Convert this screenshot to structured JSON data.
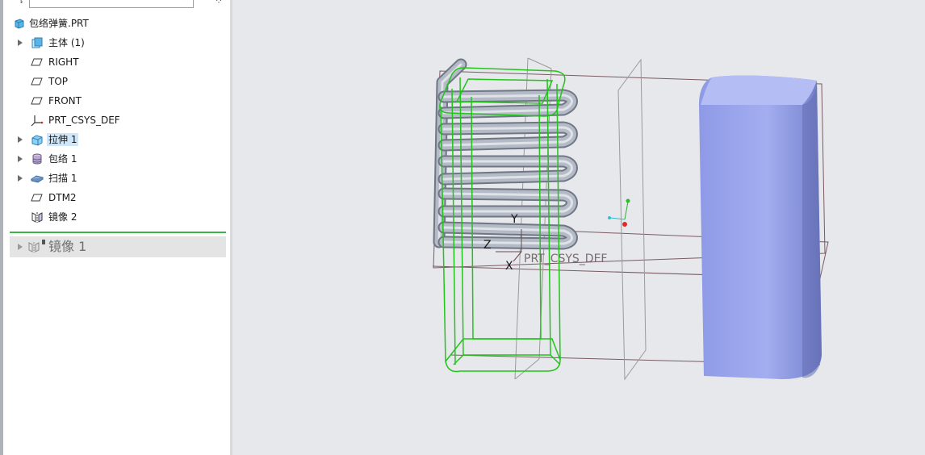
{
  "model_tree": {
    "root": {
      "label": "包络弹簧.PRT",
      "icon": "part-icon"
    },
    "items": [
      {
        "label": "主体 (1)",
        "icon": "body-icon",
        "expandable": true,
        "highlighted": false
      },
      {
        "label": "RIGHT",
        "icon": "datum-plane-icon",
        "expandable": false,
        "highlighted": false
      },
      {
        "label": "TOP",
        "icon": "datum-plane-icon",
        "expandable": false,
        "highlighted": false
      },
      {
        "label": "FRONT",
        "icon": "datum-plane-icon",
        "expandable": false,
        "highlighted": false
      },
      {
        "label": "PRT_CSYS_DEF",
        "icon": "csys-icon",
        "expandable": false,
        "highlighted": false
      },
      {
        "label": "拉伸 1",
        "icon": "extrude-icon",
        "expandable": true,
        "highlighted": true
      },
      {
        "label": "包络 1",
        "icon": "wrap-icon",
        "expandable": true,
        "highlighted": false
      },
      {
        "label": "扫描 1",
        "icon": "sweep-icon",
        "expandable": true,
        "highlighted": false
      },
      {
        "label": "DTM2",
        "icon": "datum-plane-icon",
        "expandable": false,
        "highlighted": false
      },
      {
        "label": "镜像 2",
        "icon": "mirror-icon",
        "expandable": false,
        "highlighted": false
      }
    ],
    "insert_here_item": {
      "label": "镜像 1",
      "icon": "mirror-icon",
      "expandable": true
    }
  },
  "viewport": {
    "csys_axis_y": "Y",
    "csys_axis_z": "Z",
    "csys_axis_x": "X",
    "csys_label": "PRT_CSYS_DEF",
    "colors": {
      "background": "#e7e8eb",
      "wireframe_green": "#22c41b",
      "spring": "#a9b0bc",
      "solid_block": "#9aa6ec",
      "datum_plane_edge": "#7a5a62",
      "datum_plane_gray": "#9a9a9a"
    }
  }
}
